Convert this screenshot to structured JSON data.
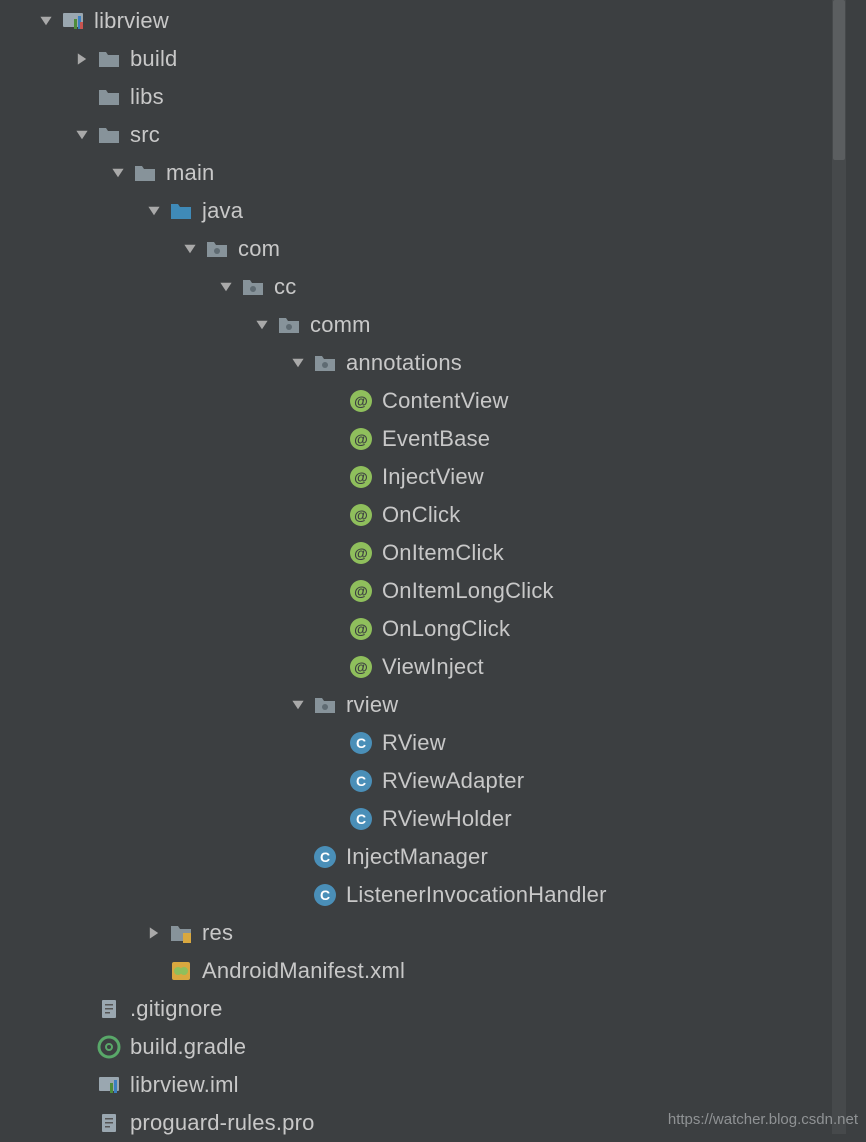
{
  "watermark": "https://watcher.blog.csdn.net",
  "tree": {
    "root": "librview",
    "build": "build",
    "libs": "libs",
    "src": "src",
    "main": "main",
    "java": "java",
    "com": "com",
    "cc": "cc",
    "comm": "comm",
    "annotations": "annotations",
    "ann": {
      "a0": "ContentView",
      "a1": "EventBase",
      "a2": "InjectView",
      "a3": "OnClick",
      "a4": "OnItemClick",
      "a5": "OnItemLongClick",
      "a6": "OnLongClick",
      "a7": "ViewInject"
    },
    "rview": "rview",
    "rv": {
      "c0": "RView",
      "c1": "RViewAdapter",
      "c2": "RViewHolder"
    },
    "commfiles": {
      "c0": "InjectManager",
      "c1": "ListenerInvocationHandler"
    },
    "res": "res",
    "manifest": "AndroidManifest.xml",
    "gitignore": ".gitignore",
    "gradle": "build.gradle",
    "iml": "librview.iml",
    "proguard": "proguard-rules.pro"
  }
}
